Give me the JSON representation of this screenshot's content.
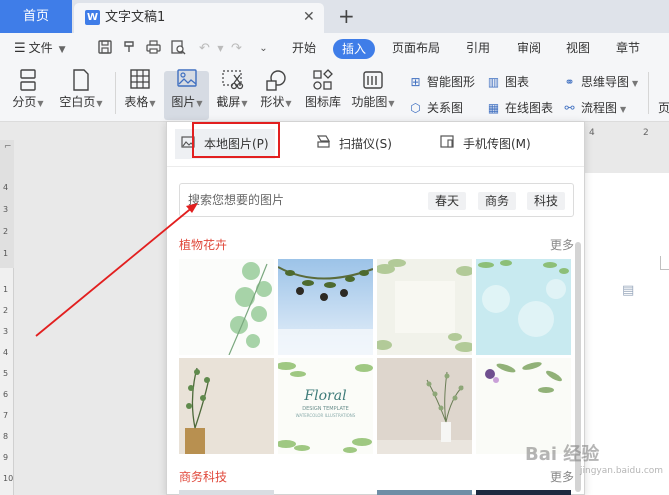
{
  "tabs": {
    "home": "首页",
    "doc_icon": "W",
    "doc_title": "文字文稿1",
    "close_glyph": "✕",
    "new_glyph": "+"
  },
  "menu": {
    "file": "文件",
    "items": [
      "开始",
      "插入",
      "页面布局",
      "引用",
      "审阅",
      "视图",
      "章节"
    ],
    "active": "插入"
  },
  "ribbon": {
    "pagebreak": "分页",
    "blankpage": "空白页",
    "table": "表格",
    "picture": "图片",
    "screenshot": "截屏",
    "shape": "形状",
    "iconlib": "图标库",
    "functionchart": "功能图",
    "smartshape": "智能图形",
    "chart": "图表",
    "mindmap": "思维导图",
    "relationmap": "关系图",
    "onlinechart": "在线图表",
    "flowchart": "流程图",
    "cutoff": "页"
  },
  "panel": {
    "tab_local": "本地图片(P)",
    "tab_scanner": "扫描仪(S)",
    "tab_phone": "手机传图(M)",
    "search_placeholder": "搜索您想要的图片",
    "tags": [
      "春天",
      "商务",
      "科技"
    ],
    "section1": "植物花卉",
    "section2": "商务科技",
    "more": "更多",
    "floral_title": "Floral",
    "floral_sub": "DESIGN TEMPLATE",
    "floral_sub2": "WATERCOLOR ILLUSTRATIONS"
  },
  "ruler": {
    "h_ticks": [
      "4",
      "2"
    ],
    "v_ticks_upper": [
      "4",
      "3",
      "2",
      "1"
    ],
    "v_ticks_lower": [
      "1",
      "2",
      "3",
      "4",
      "5",
      "6",
      "7",
      "8",
      "9",
      "10"
    ]
  },
  "watermark": {
    "main": "Bai 经验",
    "sub": "jingyan.baidu.com"
  },
  "colors": {
    "accent": "#3f7de8",
    "highlight_box": "#e21f1f",
    "section_title": "#e0483b"
  }
}
